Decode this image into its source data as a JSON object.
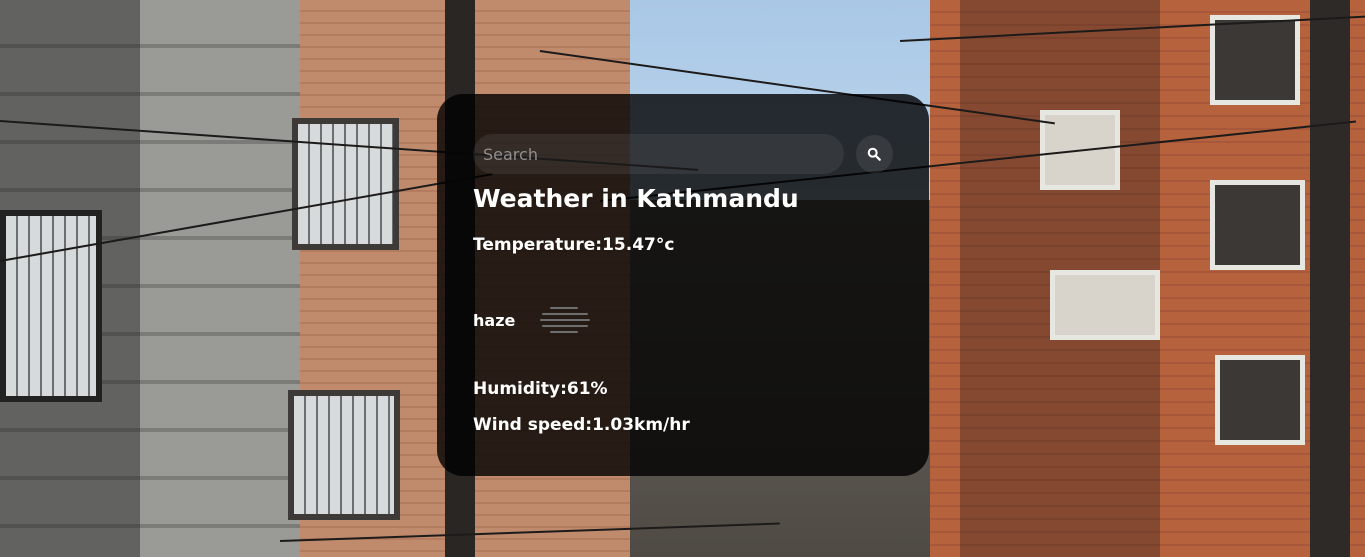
{
  "search": {
    "placeholder": "Search",
    "value": ""
  },
  "weather": {
    "city_heading": "Weather in Kathmandu",
    "temperature": "Temperature:15.47°c",
    "description": "haze",
    "humidity": "Humidity:61%",
    "wind_speed": "Wind speed:1.03km/hr"
  },
  "icons": {
    "search": "search-icon",
    "weather": "haze-icon"
  },
  "colors": {
    "card_background": "#000000",
    "text": "#ffffff"
  }
}
